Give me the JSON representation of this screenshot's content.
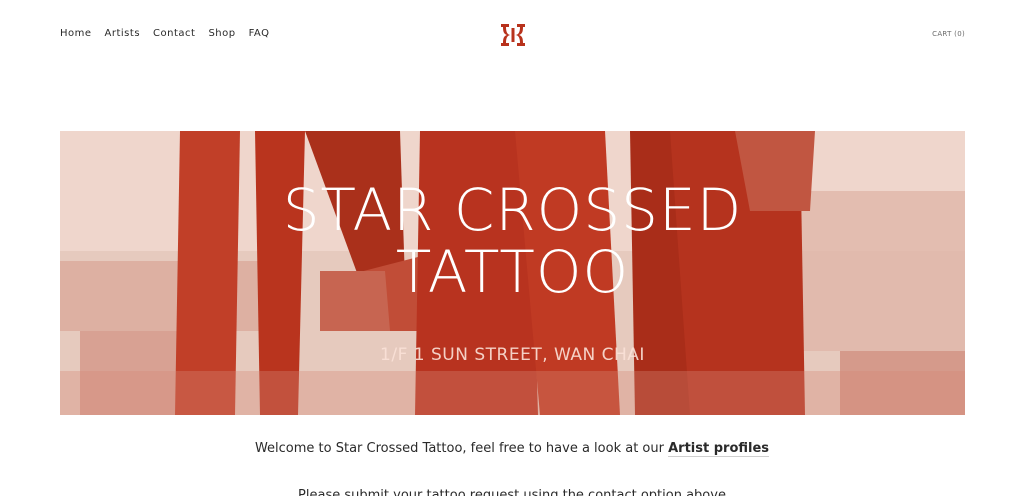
{
  "nav": {
    "items": [
      "Home",
      "Artists",
      "Contact",
      "Shop",
      "FAQ"
    ]
  },
  "logo": {
    "icon": "star-crossed-logo-icon",
    "color": "#b8321c"
  },
  "cart": {
    "label": "CART (0)"
  },
  "hero": {
    "title_line1": "STAR CROSSED",
    "title_line2": "TATTOO",
    "address": "1/F 1 SUN STREET, WAN CHAI",
    "tint": "#c0361c"
  },
  "welcome": {
    "text": "Welcome to Star Crossed Tattoo, feel free to have a look at our ",
    "link": "Artist profiles"
  },
  "submit": {
    "text": "Please submit your tattoo request using the contact option above"
  }
}
